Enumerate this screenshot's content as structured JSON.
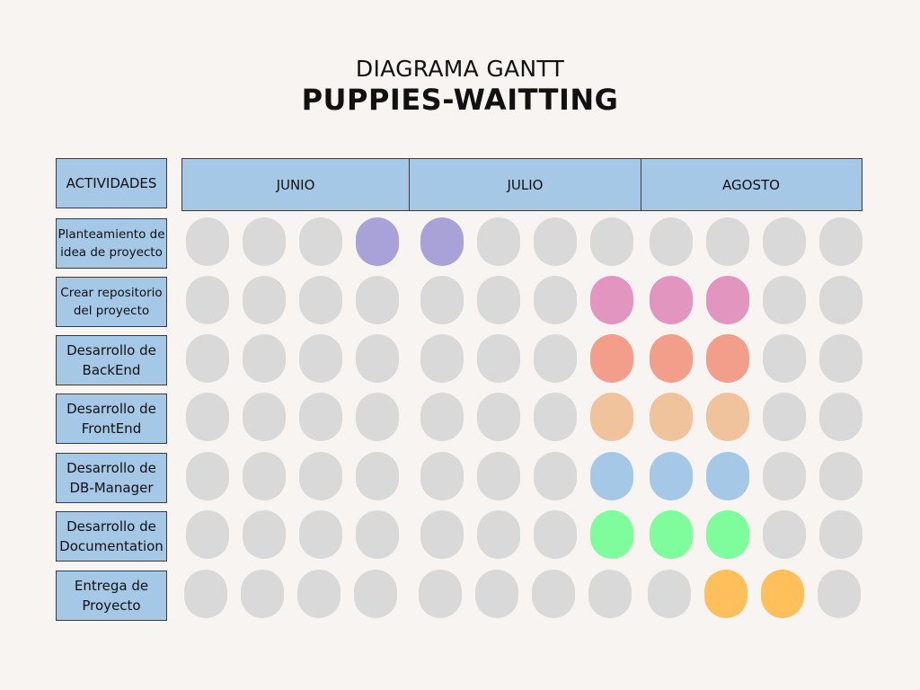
{
  "header": {
    "subtitle": "DIAGRAMA GANTT",
    "title": "PUPPIES-WAITTING"
  },
  "activities_header": "ACTIVIDADES",
  "months": [
    "JUNIO",
    "JULIO",
    "AGOSTO"
  ],
  "colors": {
    "empty": "#d9d9d9",
    "box_fill": "#a4c8e6",
    "border": "#3b3b3b",
    "background": "#f7f4f1"
  },
  "activities": [
    {
      "label": "Planteamiento de idea de proyecto",
      "color": "#a9a2d8",
      "active": [
        3,
        4
      ]
    },
    {
      "label": "Crear repositorio del proyecto",
      "color": "#e195bf",
      "active": [
        7,
        8,
        9
      ]
    },
    {
      "label": "Desarrollo de BackEnd",
      "color": "#f29e8a",
      "active": [
        7,
        8,
        9
      ]
    },
    {
      "label": "Desarrollo de FrontEnd",
      "color": "#f0c39c",
      "active": [
        7,
        8,
        9
      ]
    },
    {
      "label": "Desarrollo de DB-Manager",
      "color": "#a4c8e6",
      "active": [
        7,
        8,
        9
      ]
    },
    {
      "label": "Desarrollo de Documentation",
      "color": "#7ffd9c",
      "active": [
        7,
        8,
        9
      ]
    },
    {
      "label": "Entrega de Proyecto",
      "color": "#ffc05c",
      "active": [
        9,
        10
      ]
    }
  ]
}
